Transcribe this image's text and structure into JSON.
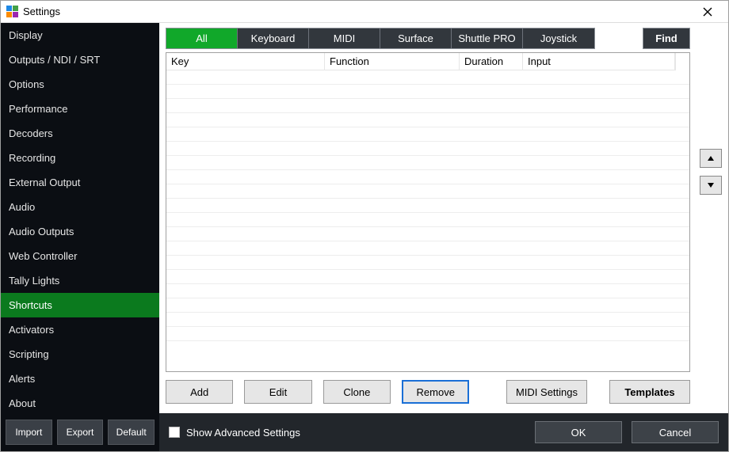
{
  "window": {
    "title": "Settings"
  },
  "sidebar": {
    "items": [
      {
        "label": "Display"
      },
      {
        "label": "Outputs / NDI / SRT"
      },
      {
        "label": "Options"
      },
      {
        "label": "Performance"
      },
      {
        "label": "Decoders"
      },
      {
        "label": "Recording"
      },
      {
        "label": "External Output"
      },
      {
        "label": "Audio"
      },
      {
        "label": "Audio Outputs"
      },
      {
        "label": "Web Controller"
      },
      {
        "label": "Tally Lights"
      },
      {
        "label": "Shortcuts",
        "active": true
      },
      {
        "label": "Activators"
      },
      {
        "label": "Scripting"
      },
      {
        "label": "Alerts"
      },
      {
        "label": "About"
      }
    ],
    "footer": {
      "import": "Import",
      "export": "Export",
      "default": "Default"
    }
  },
  "tabs": {
    "items": [
      {
        "label": "All",
        "active": true
      },
      {
        "label": "Keyboard"
      },
      {
        "label": "MIDI"
      },
      {
        "label": "Surface"
      },
      {
        "label": "Shuttle PRO"
      },
      {
        "label": "Joystick"
      }
    ],
    "find": "Find"
  },
  "grid": {
    "columns": {
      "key": "Key",
      "function": "Function",
      "duration": "Duration",
      "input": "Input"
    },
    "rows": []
  },
  "actions": {
    "add": "Add",
    "edit": "Edit",
    "clone": "Clone",
    "remove": "Remove",
    "midi_settings": "MIDI Settings",
    "templates": "Templates"
  },
  "bottom": {
    "show_advanced": "Show Advanced Settings",
    "ok": "OK",
    "cancel": "Cancel"
  },
  "logo_colors": [
    "#1e88e5",
    "#43a047",
    "#fb8c00",
    "#9c27b0"
  ]
}
